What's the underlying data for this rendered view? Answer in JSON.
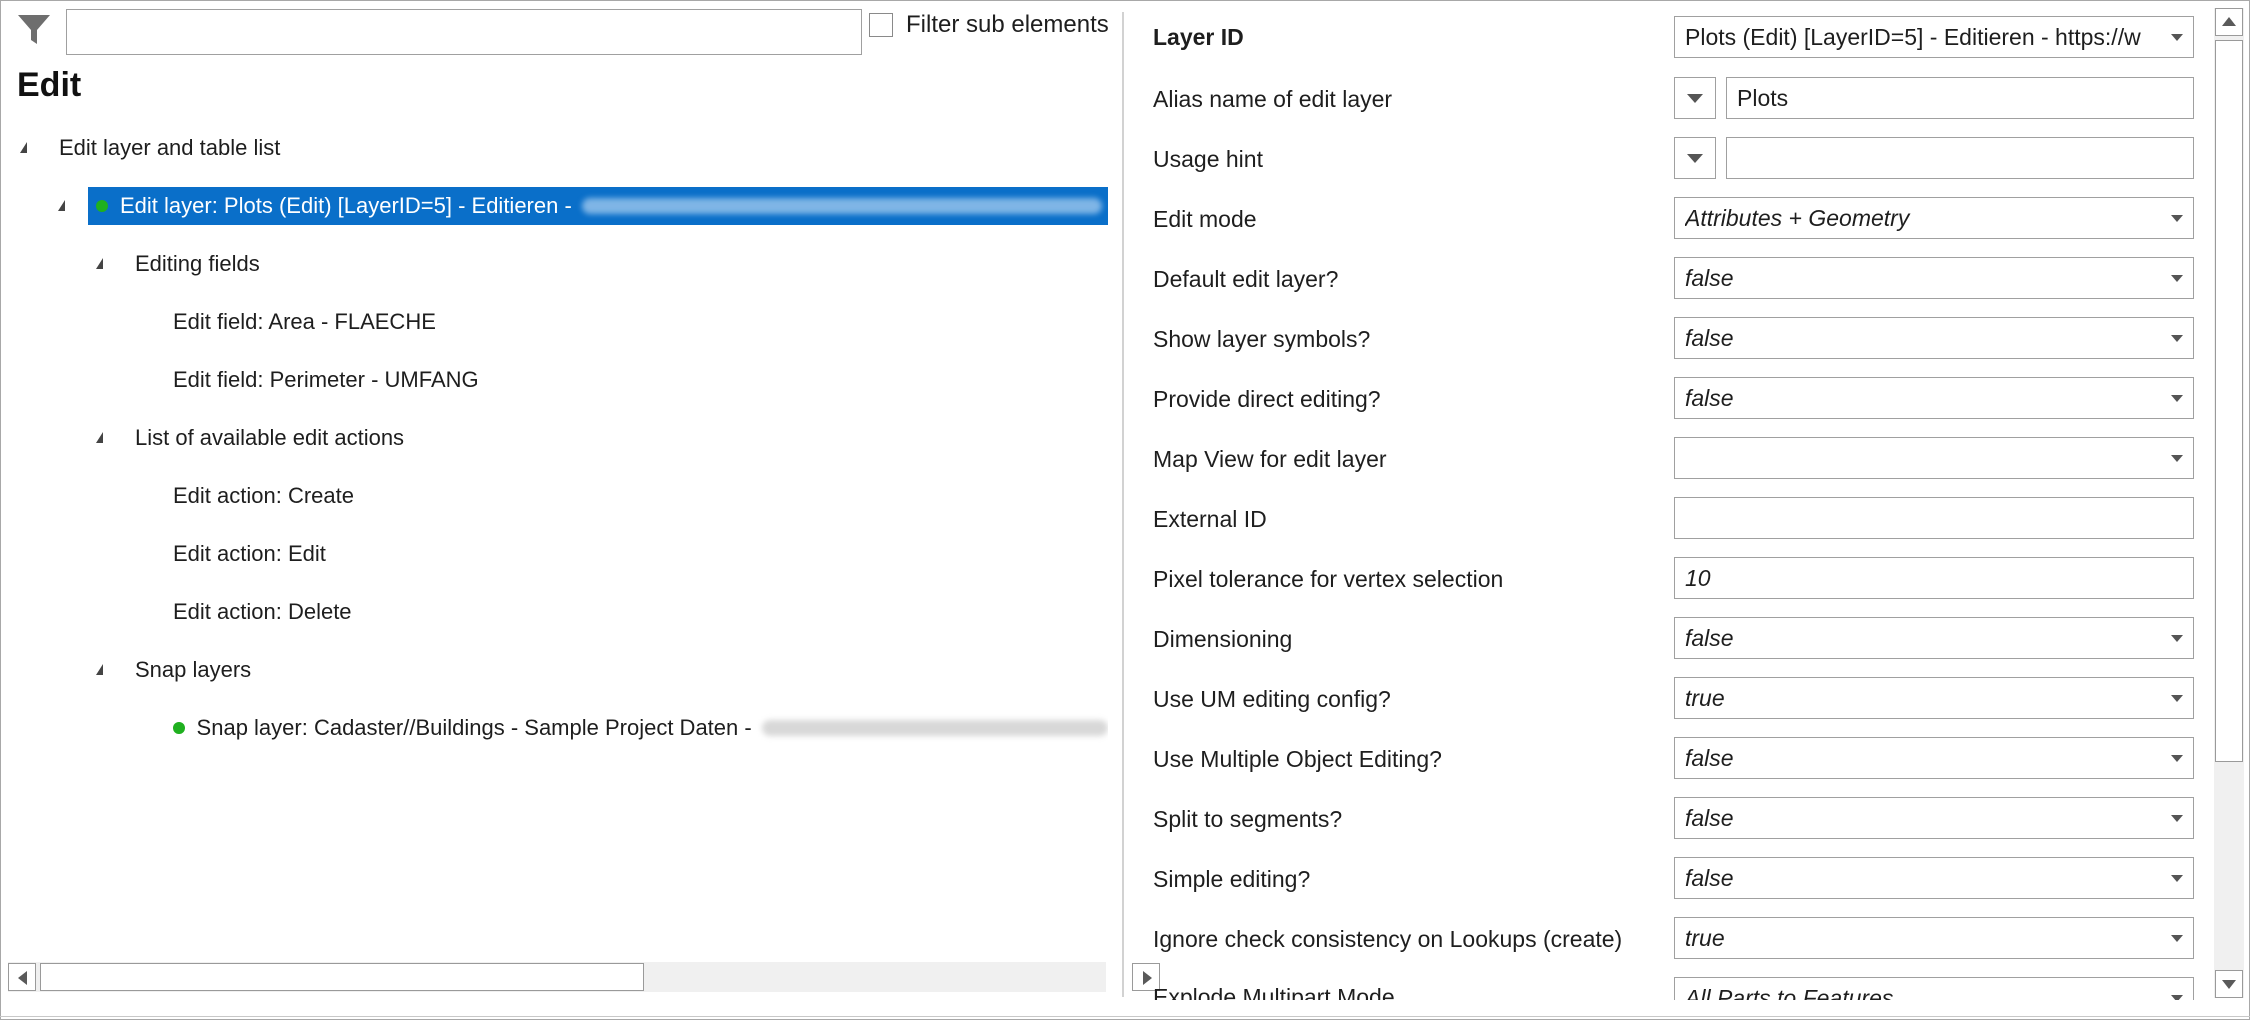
{
  "filter": {
    "input_value": "",
    "checkbox_label": "Filter sub elements",
    "icon": "filter-icon"
  },
  "panel": {
    "title": "Edit"
  },
  "tree": {
    "root": "Edit layer and table list",
    "edit_layer": "Edit layer: Plots (Edit) [LayerID=5] - Editieren -",
    "editing_fields": "Editing fields",
    "field_area": "Edit field: Area - FLAECHE",
    "field_perimeter": "Edit field: Perimeter - UMFANG",
    "actions": "List of available edit actions",
    "action_create": "Edit action: Create",
    "action_edit": "Edit action: Edit",
    "action_delete": "Edit action: Delete",
    "snap_layers": "Snap layers",
    "snap_layer": "Snap layer: Cadaster//Buildings - Sample Project Daten -"
  },
  "properties": {
    "layer_id": {
      "label": "Layer ID",
      "value": "Plots (Edit) [LayerID=5] - Editieren - https://w"
    },
    "alias": {
      "label": "Alias name of edit layer",
      "value": "Plots"
    },
    "usage_hint": {
      "label": "Usage hint",
      "value": ""
    },
    "edit_mode": {
      "label": "Edit mode",
      "value": "Attributes + Geometry"
    },
    "default_edit_layer": {
      "label": "Default edit layer?",
      "value": "false"
    },
    "show_layer_symbols": {
      "label": "Show layer symbols?",
      "value": "false"
    },
    "direct_editing": {
      "label": "Provide direct editing?",
      "value": "false"
    },
    "map_view": {
      "label": "Map View for edit layer",
      "value": ""
    },
    "external_id": {
      "label": "External ID",
      "value": ""
    },
    "pixel_tolerance": {
      "label": "Pixel tolerance for vertex selection",
      "value": "10"
    },
    "dimensioning": {
      "label": "Dimensioning",
      "value": "false"
    },
    "um_editing_config": {
      "label": "Use UM editing config?",
      "value": "true"
    },
    "multiple_object_editing": {
      "label": "Use Multiple Object Editing?",
      "value": "false"
    },
    "split_segments": {
      "label": "Split to segments?",
      "value": "false"
    },
    "simple_editing": {
      "label": "Simple editing?",
      "value": "false"
    },
    "ignore_consistency": {
      "label": "Ignore check consistency on Lookups (create)",
      "value": "true"
    },
    "explode_multipart": {
      "label": "Explode Multipart Mode",
      "value": "All Parts to Features"
    }
  },
  "colors": {
    "selection": "#0a6fc9",
    "status_dot": "#1fb01f",
    "border": "#a0a0a0"
  }
}
